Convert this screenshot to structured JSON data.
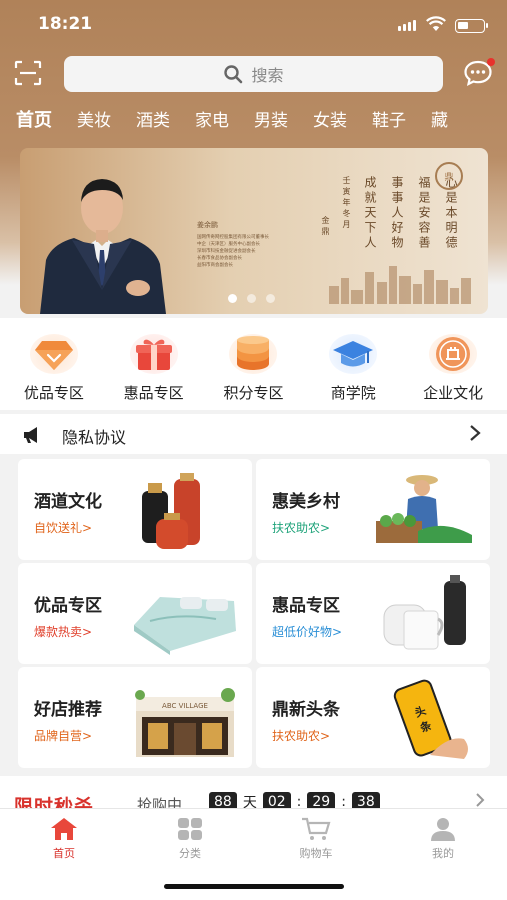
{
  "status_bar": {
    "time": "18:21"
  },
  "search": {
    "placeholder": "搜索"
  },
  "categories": [
    "首页",
    "美妆",
    "酒类",
    "家电",
    "男装",
    "女装",
    "鞋子",
    "藏"
  ],
  "banner": {
    "name": "姜余鹏",
    "bio_lines": [
      "国网传奇网控股集团有限公司董事长",
      "中企（天津区）服务中心副会长",
      "深圳市科技金融促进会副会长",
      "长春市食品协会副会长",
      "益阳市商会副会长"
    ],
    "poem": [
      "心是本明德",
      "福是安容善",
      "事事人好物",
      "成就天下人"
    ],
    "poem_note": "壬寅年冬月",
    "signature": "金鼎",
    "slides": 3,
    "active_slide": 1
  },
  "quick_entries": [
    {
      "label": "优品专区",
      "icon": "diamond-icon"
    },
    {
      "label": "惠品专区",
      "icon": "gift-icon"
    },
    {
      "label": "积分专区",
      "icon": "coin-stack-icon"
    },
    {
      "label": "商学院",
      "icon": "graduation-cap-icon"
    },
    {
      "label": "企业文化",
      "icon": "corporate-seal-icon"
    }
  ],
  "notice": {
    "text": "隐私协议"
  },
  "cards": [
    {
      "title": "酒道文化",
      "subtitle": "自饮送礼>",
      "sub_color": "#e0651c"
    },
    {
      "title": "惠美乡村",
      "subtitle": "扶农助农>",
      "sub_color": "#1fa37a"
    },
    {
      "title": "优品专区",
      "subtitle": "爆款热卖>",
      "sub_color": "#e0402c"
    },
    {
      "title": "惠品专区",
      "subtitle": "超低价好物>",
      "sub_color": "#2b8fd6"
    },
    {
      "title": "好店推荐",
      "subtitle": "品牌自营>",
      "sub_color": "#e0651c"
    },
    {
      "title": "鼎新头条",
      "subtitle": "扶农助农>",
      "sub_color": "#e0651c"
    }
  ],
  "flash": {
    "title": "限时秒杀",
    "status": "抢购中",
    "countdown": {
      "days": "88",
      "day_unit": "天",
      "hours": "02",
      "minutes": "29",
      "seconds": "38"
    }
  },
  "tabbar": [
    {
      "label": "首页",
      "icon": "home-icon",
      "active": true
    },
    {
      "label": "分类",
      "icon": "category-grid-icon",
      "active": false
    },
    {
      "label": "购物车",
      "icon": "cart-icon",
      "active": false
    },
    {
      "label": "我的",
      "icon": "profile-icon",
      "active": false
    }
  ],
  "colors": {
    "accent": "#d8322c",
    "header": "#b08259"
  }
}
